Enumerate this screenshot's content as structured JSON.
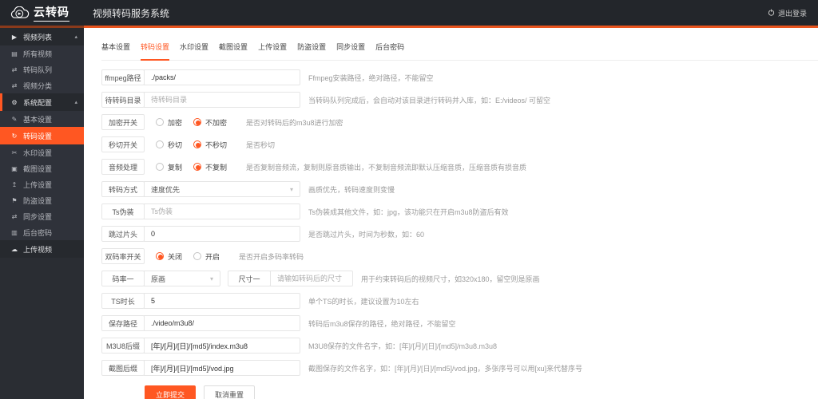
{
  "colors": {
    "accent": "#FF5722",
    "header_bg": "#23262B",
    "sidebar_bg": "#2A2D33"
  },
  "header": {
    "logo_text": "云转码",
    "app_title": "视频转码服务系统",
    "logout_label": "退出登录"
  },
  "icons": {
    "caret_up": "▴",
    "caret_down": "▾"
  },
  "sidebar": {
    "items": [
      {
        "id": "video-list",
        "type": "header",
        "label": "视频列表",
        "icon": "video-camera-icon",
        "glyph": "▶",
        "caret": true
      },
      {
        "id": "all-videos",
        "type": "item",
        "label": "所有视频",
        "icon": "video-file-icon",
        "glyph": "▤"
      },
      {
        "id": "transcode-queue",
        "type": "item",
        "label": "转码队列",
        "icon": "exchange-icon",
        "glyph": "⇄"
      },
      {
        "id": "video-category",
        "type": "item",
        "label": "视频分类",
        "icon": "exchange-icon",
        "glyph": "⇄"
      },
      {
        "id": "system-config",
        "type": "header",
        "label": "系统配置",
        "icon": "gear-icon",
        "glyph": "⚙",
        "caret": true,
        "accent": true
      },
      {
        "id": "basic-settings",
        "type": "item",
        "label": "基本设置",
        "icon": "edit-icon",
        "glyph": "✎"
      },
      {
        "id": "transcode-settings",
        "type": "item",
        "label": "转码设置",
        "icon": "refresh-icon",
        "glyph": "↻",
        "active": true
      },
      {
        "id": "watermark-settings",
        "type": "item",
        "label": "水印设置",
        "icon": "crop-icon",
        "glyph": "✂"
      },
      {
        "id": "screenshot-settings",
        "type": "item",
        "label": "截图设置",
        "icon": "image-icon",
        "glyph": "▣"
      },
      {
        "id": "upload-settings",
        "type": "item",
        "label": "上传设置",
        "icon": "upload-icon",
        "glyph": "↥"
      },
      {
        "id": "antitheft-settings",
        "type": "item",
        "label": "防盗设置",
        "icon": "flag-icon",
        "glyph": "⚑"
      },
      {
        "id": "sync-settings",
        "type": "item",
        "label": "同步设置",
        "icon": "sync-icon",
        "glyph": "⇄"
      },
      {
        "id": "admin-password",
        "type": "item",
        "label": "后台密码",
        "icon": "address-book-icon",
        "glyph": "▥"
      },
      {
        "id": "upload-video",
        "type": "header",
        "label": "上传视频",
        "icon": "cloud-upload-icon",
        "glyph": "☁"
      }
    ]
  },
  "tabs": {
    "active_index": 1,
    "items": [
      {
        "id": "basic",
        "label": "基本设置"
      },
      {
        "id": "transcode",
        "label": "转码设置"
      },
      {
        "id": "watermark",
        "label": "水印设置"
      },
      {
        "id": "screenshot",
        "label": "截图设置"
      },
      {
        "id": "upload",
        "label": "上传设置"
      },
      {
        "id": "antitheft",
        "label": "防盗设置"
      },
      {
        "id": "sync",
        "label": "同步设置"
      },
      {
        "id": "password",
        "label": "后台密码"
      }
    ]
  },
  "form": {
    "rows": [
      {
        "id": "ffmpeg-path",
        "type": "input",
        "label": "ffmpeg路径",
        "value": "./packs/",
        "hint": "Ffmpeg安装路径，绝对路径，不能留空"
      },
      {
        "id": "pending-dir",
        "type": "input",
        "label": "待转码目录",
        "placeholder": "待转码目录",
        "hint": "当转码队列完成后，会自动对该目录进行转码并入库，如：E:/videos/ 可留空"
      },
      {
        "id": "encrypt-switch",
        "type": "radio",
        "label": "加密开关",
        "options": [
          "加密",
          "不加密"
        ],
        "selected": 1,
        "hint": "是否对转码后的m3u8进行加密"
      },
      {
        "id": "quickcut-switch",
        "type": "radio",
        "label": "秒切开关",
        "options": [
          "秒切",
          "不秒切"
        ],
        "selected": 1,
        "hint": "是否秒切"
      },
      {
        "id": "audio-handling",
        "type": "radio",
        "label": "音频处理",
        "options": [
          "复制",
          "不复制"
        ],
        "selected": 1,
        "hint": "是否复制音频流，复制则原音质输出，不复制音频流即默认压缩音质，压缩音质有损音质"
      },
      {
        "id": "transcode-mode",
        "type": "select",
        "label": "转码方式",
        "value": "速度优先",
        "hint": "画质优先，转码速度则变慢"
      },
      {
        "id": "ts-disguise",
        "type": "input",
        "label": "Ts伪装",
        "placeholder": "Ts伪装",
        "hint": "Ts伪装成其他文件，如：jpg，该功能只在开启m3u8防盗后有效"
      },
      {
        "id": "skip-intro",
        "type": "input",
        "label": "跳过片头",
        "value": "0",
        "hint": "是否跳过片头，时间为秒数，如：60"
      },
      {
        "id": "dual-bitrate-switch",
        "type": "radio",
        "label": "双码率开关",
        "options": [
          "关闭",
          "开启"
        ],
        "selected": 0,
        "hint": "是否开启多码率转码"
      },
      {
        "id": "bitrate-one",
        "type": "dual",
        "label": "码率一",
        "value": "原画",
        "label2": "尺寸一",
        "placeholder2": "请输如转码后的尺寸",
        "hint": "用于约束转码后的视频尺寸，如320x180，留空则是原画"
      },
      {
        "id": "ts-duration",
        "type": "input",
        "label": "TS时长",
        "value": "5",
        "hint": "单个TS的时长，建议设置为10左右"
      },
      {
        "id": "save-path",
        "type": "input",
        "label": "保存路径",
        "value": "./video/m3u8/",
        "hint": "转码后m3u8保存的路径，绝对路径，不能留空"
      },
      {
        "id": "m3u8-suffix",
        "type": "input",
        "label": "M3U8后缀",
        "value": "[年]/[月]/[日]/[md5]/index.m3u8",
        "hint": "M3U8保存的文件名字，如：[年]/[月]/[日]/[md5]/m3u8.m3u8"
      },
      {
        "id": "screenshot-suffix",
        "type": "input",
        "label": "截图后缀",
        "value": "[年]/[月]/[日]/[md5]/vod.jpg",
        "hint": "截图保存的文件名字，如：[年]/[月]/[日]/[md5]/vod.jpg，多张序号可以用[xu]来代替序号"
      }
    ],
    "submit_label": "立即提交",
    "reset_label": "取消重置"
  }
}
